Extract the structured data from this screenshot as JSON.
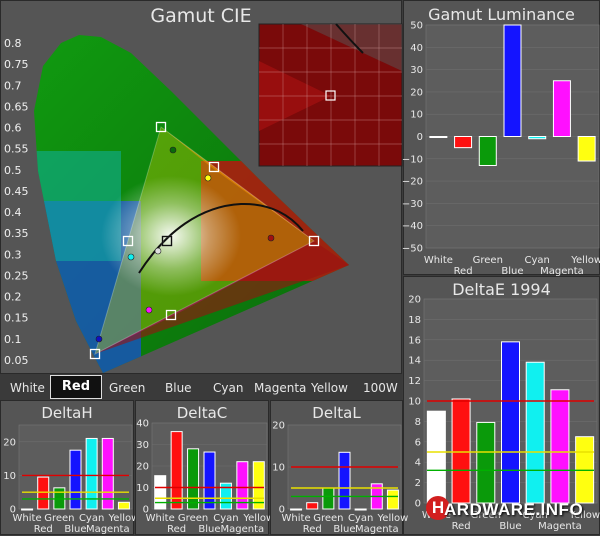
{
  "cie": {
    "title": "Gamut CIE",
    "ticks": [
      "0.8",
      "0.75",
      "0.7",
      "0.65",
      "0.6",
      "0.55",
      "0.5",
      "0.45",
      "0.4",
      "0.35",
      "0.3",
      "0.25",
      "0.2",
      "0.15",
      "0.1",
      "0.05"
    ],
    "selector": {
      "items": [
        "White",
        "Red",
        "Green",
        "Blue",
        "Cyan",
        "Magenta",
        "Yellow",
        "100W"
      ],
      "active": "Red"
    }
  },
  "luminance": {
    "title": "Gamut Luminance",
    "ticks": [
      "50",
      "40",
      "30",
      "20",
      "10",
      "0",
      "−10",
      "−20",
      "−30",
      "−40",
      "−50"
    ],
    "categories": [
      "White",
      "Red",
      "Green",
      "Blue",
      "Cyan",
      "Magenta",
      "Yellow"
    ],
    "values": [
      0,
      -5,
      -13,
      50,
      -1,
      25,
      -11
    ]
  },
  "deltae": {
    "title": "DeltaE 1994",
    "ticks": [
      "20",
      "18",
      "16",
      "14",
      "12",
      "10",
      "8",
      "6",
      "4",
      "2",
      "0"
    ],
    "categories": [
      "White",
      "Red",
      "Green",
      "Blue",
      "Cyan",
      "Magenta",
      "Yellow"
    ],
    "values": [
      9,
      10.2,
      7.9,
      15.8,
      13.8,
      11.1,
      6.5
    ],
    "refs": [
      10,
      5,
      3.2
    ]
  },
  "deltah": {
    "title": "DeltaH",
    "ticks": [
      "20",
      "10",
      "0"
    ],
    "categories": [
      "White",
      "Red",
      "Green",
      "Blue",
      "Cyan",
      "Magenta",
      "Yellow"
    ],
    "values": [
      0,
      9.5,
      6.3,
      17.5,
      21,
      21,
      2
    ],
    "refs": [
      10,
      5,
      3
    ]
  },
  "deltac": {
    "title": "DeltaC",
    "ticks": [
      "40",
      "30",
      "20",
      "10",
      "0"
    ],
    "categories": [
      "White",
      "Red",
      "Green",
      "Blue",
      "Cyan",
      "Magenta",
      "Yellow"
    ],
    "values": [
      15.5,
      36,
      28,
      26.5,
      12,
      22,
      22
    ],
    "refs": [
      10,
      5,
      3
    ]
  },
  "deltal": {
    "title": "DeltaL",
    "ticks": [
      "20",
      "10",
      "0"
    ],
    "categories": [
      "White",
      "Red",
      "Green",
      "Blue",
      "Cyan",
      "Magenta",
      "Yellow"
    ],
    "values": [
      0,
      1.5,
      5,
      13.5,
      0,
      6,
      4.5
    ],
    "refs": [
      10,
      5,
      3
    ]
  },
  "colors": {
    "White": "#ffffff",
    "Red": "#ff1010",
    "Green": "#0a9a0a",
    "Blue": "#1414ff",
    "Cyan": "#10f0f0",
    "Magenta": "#ff10ff",
    "Yellow": "#ffff10",
    "ref_hi": "#e00000",
    "ref_mid": "#e8e000",
    "ref_lo": "#00b000"
  },
  "chart_data": [
    {
      "type": "scatter",
      "title": "Gamut CIE",
      "xlabel": "",
      "ylabel": "",
      "ylim": [
        0,
        0.85
      ],
      "series": [
        {
          "name": "Red",
          "x": [
            0.64,
            0.64
          ],
          "y": [
            0.33,
            0.34
          ]
        },
        {
          "name": "Green",
          "x": [
            0.3,
            0.33
          ],
          "y": [
            0.6,
            0.55
          ]
        },
        {
          "name": "Blue",
          "x": [
            0.15,
            0.16
          ],
          "y": [
            0.06,
            0.08
          ]
        },
        {
          "name": "Cyan",
          "x": [
            0.225,
            0.235
          ],
          "y": [
            0.33,
            0.3
          ]
        },
        {
          "name": "Magenta",
          "x": [
            0.32,
            0.29
          ],
          "y": [
            0.155,
            0.17
          ]
        },
        {
          "name": "Yellow",
          "x": [
            0.42,
            0.41
          ],
          "y": [
            0.505,
            0.48
          ]
        },
        {
          "name": "White",
          "x": [
            0.313,
            0.3
          ],
          "y": [
            0.329,
            0.31
          ]
        }
      ]
    },
    {
      "type": "bar",
      "title": "Gamut Luminance",
      "categories": [
        "White",
        "Red",
        "Green",
        "Blue",
        "Cyan",
        "Magenta",
        "Yellow"
      ],
      "values": [
        0,
        -5,
        -13,
        50,
        -1,
        25,
        -11
      ],
      "ylim": [
        -50,
        50
      ]
    },
    {
      "type": "bar",
      "title": "DeltaE 1994",
      "categories": [
        "White",
        "Red",
        "Green",
        "Blue",
        "Cyan",
        "Magenta",
        "Yellow"
      ],
      "values": [
        9,
        10.2,
        7.9,
        15.8,
        13.8,
        11.1,
        6.5
      ],
      "ylim": [
        0,
        20
      ]
    },
    {
      "type": "bar",
      "title": "DeltaH",
      "categories": [
        "White",
        "Red",
        "Green",
        "Blue",
        "Cyan",
        "Magenta",
        "Yellow"
      ],
      "values": [
        0,
        9.5,
        6.3,
        17.5,
        21,
        21,
        2
      ],
      "ylim": [
        0,
        25
      ]
    },
    {
      "type": "bar",
      "title": "DeltaC",
      "categories": [
        "White",
        "Red",
        "Green",
        "Blue",
        "Cyan",
        "Magenta",
        "Yellow"
      ],
      "values": [
        15.5,
        36,
        28,
        26.5,
        12,
        22,
        22
      ],
      "ylim": [
        0,
        40
      ]
    },
    {
      "type": "bar",
      "title": "DeltaL",
      "categories": [
        "White",
        "Red",
        "Green",
        "Blue",
        "Cyan",
        "Magenta",
        "Yellow"
      ],
      "values": [
        0,
        1.5,
        5,
        13.5,
        0,
        6,
        4.5
      ],
      "ylim": [
        0,
        20
      ]
    }
  ],
  "watermark": {
    "letter": "H",
    "text": "ARDWARE.INFO"
  }
}
